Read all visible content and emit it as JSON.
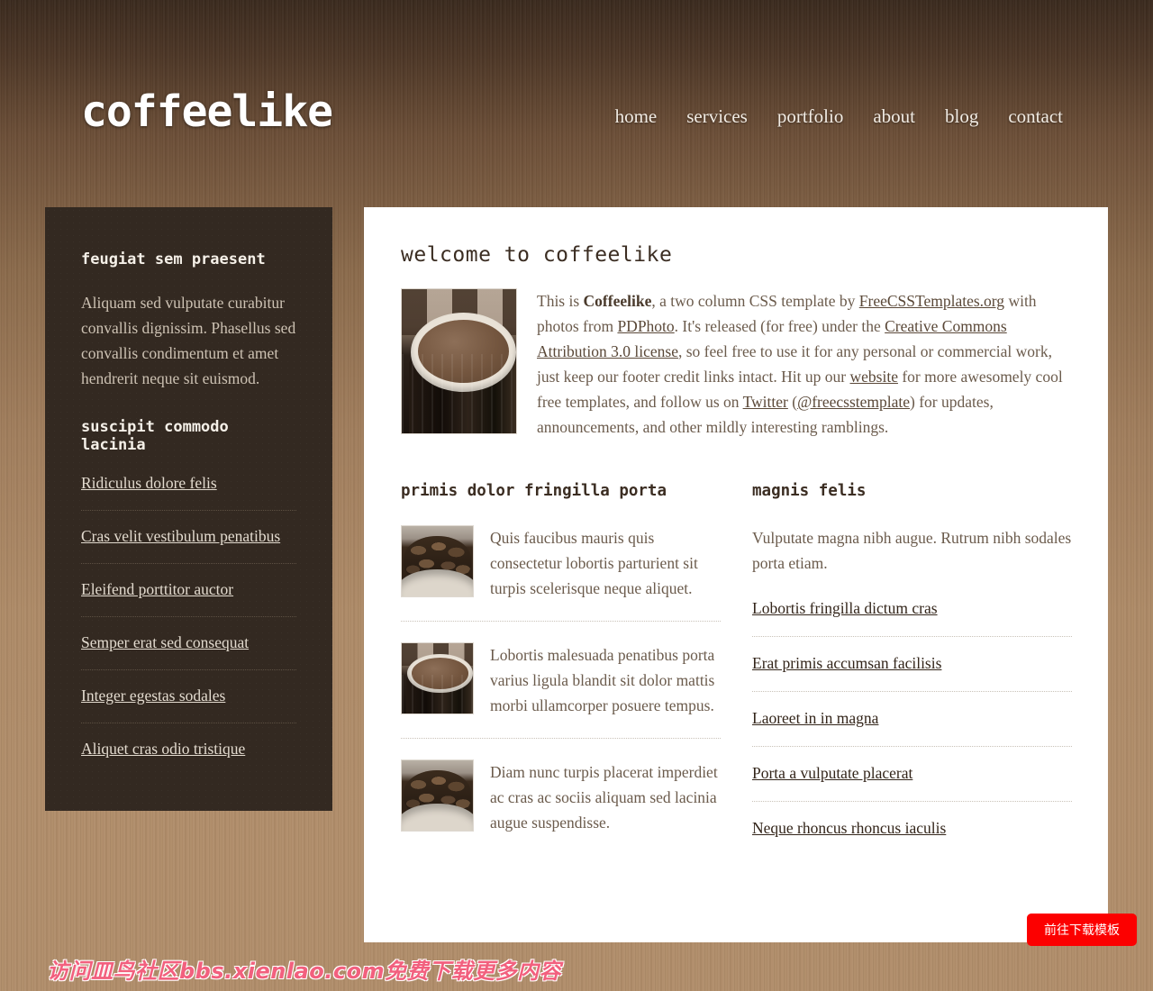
{
  "site": {
    "logo": "coffeelike"
  },
  "nav": {
    "items": [
      {
        "label": "home"
      },
      {
        "label": "services"
      },
      {
        "label": "portfolio"
      },
      {
        "label": "about"
      },
      {
        "label": "blog"
      },
      {
        "label": "contact"
      }
    ]
  },
  "sidebar": {
    "heading1": "feugiat sem praesent",
    "paragraph": "Aliquam sed vulputate curabitur convallis dignissim. Phasellus sed convallis condimentum et amet hendrerit neque sit euismod.",
    "heading2": "suscipit commodo lacinia",
    "links": [
      {
        "label": "Ridiculus dolore felis"
      },
      {
        "label": "Cras velit vestibulum penatibus"
      },
      {
        "label": "Eleifend porttitor auctor"
      },
      {
        "label": "Semper erat sed consequat"
      },
      {
        "label": "Integer egestas sodales"
      },
      {
        "label": "Aliquet cras odio tristique"
      }
    ]
  },
  "main": {
    "title": "welcome to coffeelike",
    "intro": {
      "image_alt": "coffee-cup-photo",
      "text_part1": "This is ",
      "brand": "Coffeelike",
      "text_part2": ", a two column CSS template by ",
      "link_freecss": "FreeCSSTemplates.org",
      "text_part3": " with photos from ",
      "link_pdphoto": "PDPhoto",
      "text_part4": ". It's released (for free) under the ",
      "link_license": "Creative Commons Attribution 3.0 license",
      "text_part5": ", so feel free to use it for any personal or commercial work, just keep our footer credit links intact. Hit up our ",
      "link_website": "website",
      "text_part6": " for more awesomely cool free templates, and follow us on ",
      "link_twitter": "Twitter",
      "text_part7": " (",
      "link_handle": "@freecsstemplate",
      "text_part8": ") for updates, announcements, and other mildly interesting ramblings."
    },
    "left_column": {
      "heading": "primis dolor fringilla porta",
      "items": [
        {
          "image": "coffee-beans-photo",
          "text": "Quis faucibus mauris quis consectetur lobortis parturient sit turpis scelerisque neque aliquet."
        },
        {
          "image": "coffee-cup-photo",
          "text": "Lobortis malesuada penatibus porta varius ligula blandit sit dolor mattis morbi ullamcorper posuere tempus."
        },
        {
          "image": "coffee-beans-photo",
          "text": "Diam nunc turpis placerat imperdiet ac cras ac sociis aliquam sed lacinia augue suspendisse."
        }
      ]
    },
    "right_column": {
      "heading": "magnis felis",
      "intro": "Vulputate magna nibh augue. Rutrum nibh sodales porta etiam.",
      "links": [
        {
          "label": "Lobortis fringilla dictum cras"
        },
        {
          "label": "Erat primis accumsan facilisis"
        },
        {
          "label": "Laoreet in in magna"
        },
        {
          "label": "Porta a vulputate placerat"
        },
        {
          "label": "Neque rhoncus rhoncus iaculis"
        }
      ]
    }
  },
  "overlay": {
    "watermark": "访问皿鸟社区bbs.xienlao.com免费下载更多内容",
    "download_button": "前往下载模板"
  },
  "colors": {
    "page_top": "#3a2a1e",
    "page_bottom": "#b08d6a",
    "sidebar_bg": "#332921",
    "panel_bg": "#ffffff",
    "heading": "#3b2d22",
    "body_text": "#6b5b4c",
    "link": "#33251a",
    "accent_red": "#fc0000",
    "watermark_pink": "#f2607e"
  }
}
